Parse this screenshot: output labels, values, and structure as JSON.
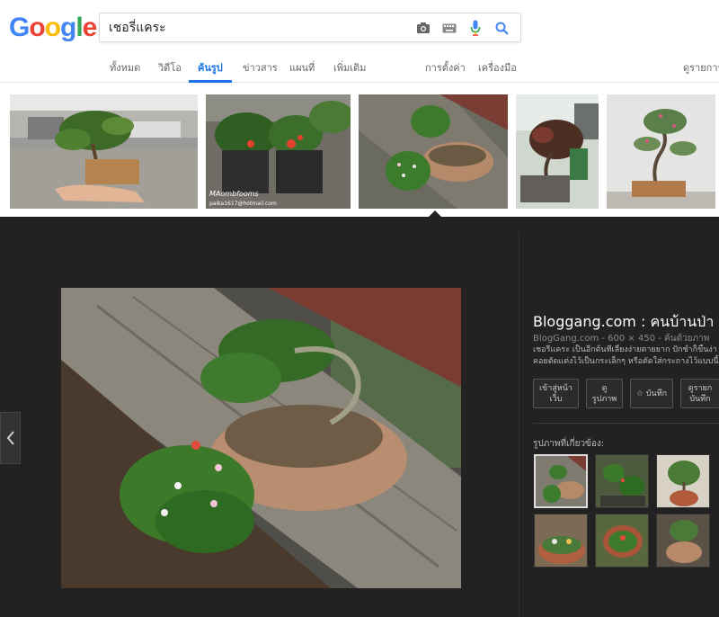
{
  "header": {
    "logo_letters": [
      "G",
      "o",
      "o",
      "g",
      "l",
      "e"
    ],
    "logo_colors": [
      "#4285F4",
      "#EA4335",
      "#FBBC05",
      "#4285F4",
      "#34A853",
      "#EA4335"
    ],
    "search_value": "เชอรี่แคระ",
    "tabs": [
      {
        "label": "ทั้งหมด"
      },
      {
        "label": "วิดีโอ"
      },
      {
        "label": "ค้นรูป"
      },
      {
        "label": "ข่าวสาร"
      },
      {
        "label": "แผนที่"
      },
      {
        "label": "เพิ่มเติม"
      }
    ],
    "settings_label": "การตั้งค่า",
    "tools_label": "เครื่องมือ",
    "view_saved_label": "ดูรายการที่"
  },
  "thumbnails": [
    {
      "icon": "bonsai-hand-photo"
    },
    {
      "icon": "potted-flower-photo",
      "watermark": "MAombfooms",
      "watermark2": "paika1617@hotmail.com"
    },
    {
      "icon": "bonsai-bench-photo"
    },
    {
      "icon": "bonsai-rocky-photo"
    },
    {
      "icon": "bonsai-white-photo"
    }
  ],
  "detail": {
    "title": "Bloggang.com : คนบ้านป่า : พ",
    "meta": "BlogGang.com - 600 × 450 - ค้นด้วยภาพ",
    "desc_line1": "เชอรี่แคระ เป็นอีกต้นที่เลี้ยงง่ายตายยาก ปักชำก็ขึ้นง่า",
    "desc_line2": "คอยตัดแต่งไว้เป็นกระเล็กๆ หรือตัดใส่กระถางไว้แบบนี้",
    "buttons": [
      {
        "line1": "เข้าสู่หน้า",
        "line2": "เว็บ"
      },
      {
        "line1": "ดู",
        "line2": "รูปภาพ"
      },
      {
        "line1": "☆ บันทึก",
        "line2": ""
      },
      {
        "line1": "ดูรายก",
        "line2": "บันทึก"
      }
    ],
    "related_label": "รูปภาพที่เกี่ยวข้อง:"
  },
  "colors": {
    "accent": "#1a73e8",
    "panel_bg": "#222222"
  }
}
